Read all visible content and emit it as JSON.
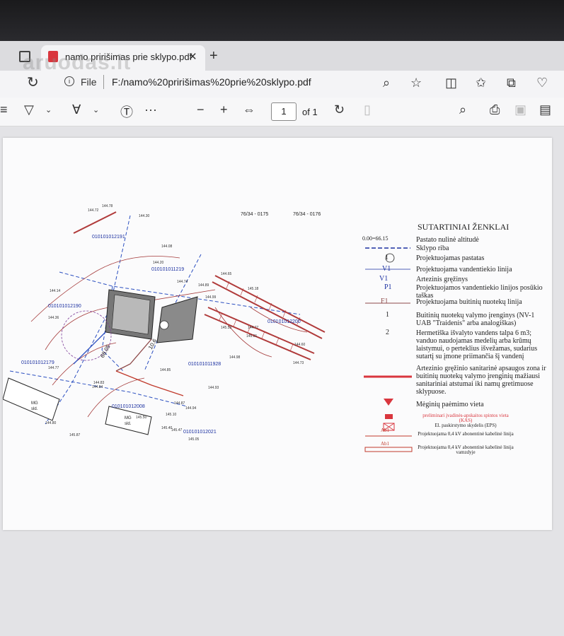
{
  "browser": {
    "tab_title": "namo pririšimas prie sklypo.pdf",
    "tab_close": "✕",
    "new_tab": "+",
    "watermark": "aruodas.lt",
    "address": {
      "file_label": "File",
      "url": "F:/namo%20pririšimas%20prie%20sklypo.pdf"
    }
  },
  "pdf_toolbar": {
    "page_number": "1",
    "page_of": "of 1",
    "zoom_out": "−",
    "zoom_in": "+",
    "more": "···"
  },
  "document": {
    "sheet_numbers": [
      "76/34 - 0175",
      "76/34 - 0176"
    ],
    "legend": {
      "title": "SUTARTINIAI ŽENKLAI",
      "items": [
        {
          "mark": "0.00=66.15",
          "text": "Pastato nulinė altitudė"
        },
        {
          "mark": "",
          "text": "Sklypo riba"
        },
        {
          "mark": "1",
          "text": "Projektuojamas pastatas"
        },
        {
          "mark": "V1",
          "text": "Projektuojama vandentiekio linija"
        },
        {
          "mark": "V1",
          "text": "Artezinis gręžinys"
        },
        {
          "mark": "P1",
          "text": "Projektuojamos vandentiekio linijos posūkio taškas"
        },
        {
          "mark": "F1",
          "text": "Projektuojama buitinių nuotekų linija"
        },
        {
          "mark": "1",
          "text": "Buitinių nuotekų valymo įrenginys (NV-1 UAB \"Traidenis\" arba analogiškas)"
        },
        {
          "mark": "2",
          "text": "Hermetiška išvalyto vandens talpa 6 m3; vanduo naudojamas medelių arba krūmų laistymui, o perteklius išvežamas, sudarius sutartį su įmone priimančia šį vandenį"
        },
        {
          "mark": "",
          "text": "Artezinio gręžinio sanitarinė apsaugos zona ir buitinių nuotekų valymo įrenginių mažiausi sanitariniai atstumai iki namų gretimuose sklypuose."
        },
        {
          "mark": "",
          "text": "Mėginių paėmimo vieta"
        },
        {
          "mark": "",
          "text": "preliminari įvadinės-apskaitos spintos vieta (KAS)"
        },
        {
          "mark": "",
          "text": "El. paskirstymo skydelis (EPS)"
        },
        {
          "mark": "Ab1",
          "text": "Projektuojama 0,4 kV abonentinė kabelinė linija"
        },
        {
          "mark": "Ab1",
          "text": "Projektuojama 0,4 kV abonentinė kabelinė linija vamzdyje"
        }
      ]
    },
    "plan_labels": {
      "parcels": [
        "010101012191",
        "010101011219",
        "010101012190",
        "010101012200",
        "010101012179",
        "010101011928",
        "010101012008",
        "010101012021"
      ],
      "neighbor_building": "MG\nSLD.",
      "elevations": [
        "144.78",
        "144.72",
        "144.30",
        "144.08",
        "144.20",
        "144.65",
        "144.74",
        "144.89",
        "144.14",
        "144.36",
        "145.18",
        "144.99",
        "144.77",
        "145.53",
        "145.01",
        "144.98",
        "144.60",
        "144.73",
        "144.85",
        "144.93",
        "144.77",
        "144.87",
        "144.94",
        "144.83",
        "145.50",
        "145.10",
        "145.40",
        "145.47",
        "145.05",
        "144.80",
        "144.84",
        "145.87"
      ],
      "dimensions": [
        "68.05",
        "10.6"
      ]
    }
  },
  "colors": {
    "accent_blue": "#1a2fa0",
    "pipeline_red": "#c0392b",
    "sanitary_zone": "#d9363e",
    "sewer_line": "#8e4a4a"
  }
}
